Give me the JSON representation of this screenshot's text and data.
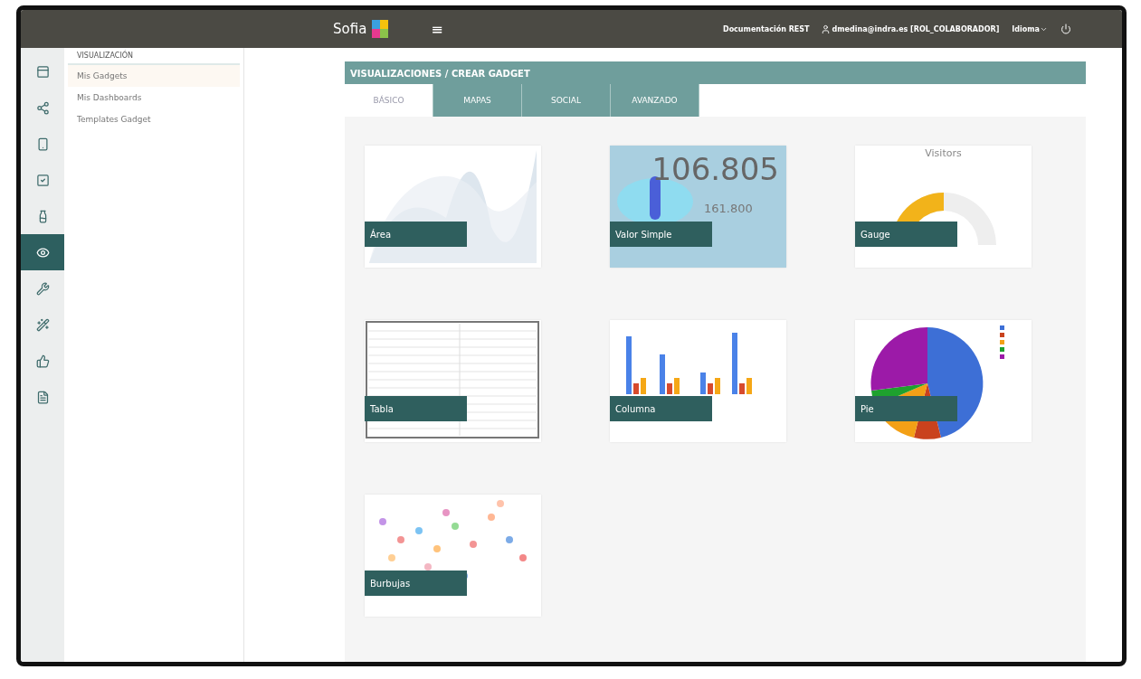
{
  "topbar": {
    "logo": "Sofia",
    "menu_glyph": "≡",
    "links": [
      "Documentación REST",
      "dmedina@indra.es [ROL_COLABORADOR]",
      "Idioma"
    ]
  },
  "rail": [
    {
      "selected": false
    },
    {
      "selected": false
    },
    {
      "selected": false
    },
    {
      "selected": false
    },
    {
      "selected": false
    },
    {
      "selected": true
    },
    {
      "selected": false
    },
    {
      "selected": false
    },
    {
      "selected": false
    },
    {
      "selected": false
    }
  ],
  "submenu": {
    "title": "VISUALIZACIÓN",
    "items": [
      {
        "label": "Mis Gadgets",
        "selected": true
      },
      {
        "label": "Mis Dashboards",
        "selected": false
      },
      {
        "label": "Templates Gadget",
        "selected": false
      }
    ]
  },
  "panel": {
    "title": "VISUALIZACIONES / CREAR GADGET",
    "tabs": [
      {
        "label": "BÁSICO",
        "selected": true
      },
      {
        "label": "MAPAS",
        "selected": false
      },
      {
        "label": "SOCIAL",
        "selected": false
      },
      {
        "label": "AVANZADO",
        "selected": false
      }
    ],
    "gadgets": [
      {
        "kind": "area",
        "label": "Área"
      },
      {
        "kind": "value",
        "label": "Valor Simple",
        "value": "106.805",
        "sub": "161.800"
      },
      {
        "kind": "gauge",
        "label": "Gauge",
        "title": "Visitors"
      },
      {
        "kind": "table",
        "label": "Tabla"
      },
      {
        "kind": "column",
        "label": "Columna"
      },
      {
        "kind": "pie",
        "label": "Pie"
      },
      {
        "kind": "bubble",
        "label": "Burbujas"
      }
    ]
  }
}
